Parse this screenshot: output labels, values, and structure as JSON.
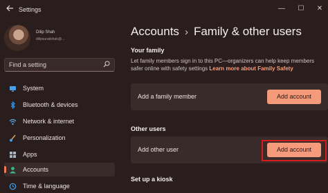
{
  "window": {
    "title": "Settings",
    "back_icon": "back-arrow-icon",
    "minimize_glyph": "—",
    "maximize_glyph": "☐",
    "close_glyph": "✕"
  },
  "user": {
    "name": "Dilip Shah",
    "email": "dilipsuratishah@..."
  },
  "search": {
    "placeholder": "Find a setting",
    "icon": "search-icon"
  },
  "sidebar": {
    "items": [
      {
        "label": "System",
        "icon": "monitor-icon",
        "color": "#4aa0e6",
        "active": false
      },
      {
        "label": "Bluetooth & devices",
        "icon": "bluetooth-icon",
        "color": "#3b8fd9",
        "active": false
      },
      {
        "label": "Network & internet",
        "icon": "wifi-icon",
        "color": "#5aa9e6",
        "active": false
      },
      {
        "label": "Personalization",
        "icon": "brush-icon",
        "color": "#e0a050",
        "active": false
      },
      {
        "label": "Apps",
        "icon": "apps-grid-icon",
        "color": "#a7b4c4",
        "active": false
      },
      {
        "label": "Accounts",
        "icon": "person-icon",
        "color": "#3bb58a",
        "active": true
      },
      {
        "label": "Time & language",
        "icon": "globe-clock-icon",
        "color": "#4aa0e6",
        "active": false
      }
    ]
  },
  "main": {
    "breadcrumb_parent": "Accounts",
    "breadcrumb_separator": "›",
    "breadcrumb_current": "Family & other users",
    "your_family": {
      "title": "Your family",
      "description": "Let family members sign in to this PC—organizers can help keep members safer online with safety settings",
      "learn_more": "Learn more about Family Safety",
      "card_label": "Add a family member",
      "button": "Add account"
    },
    "other_users": {
      "title": "Other users",
      "card_label": "Add other user",
      "button": "Add account"
    },
    "kiosk": {
      "title": "Set up a kiosk"
    }
  },
  "colors": {
    "background": "#2a1d1d",
    "card": "#3a2b2b",
    "accent": "#f59a7a",
    "link": "#f6a07e",
    "highlight_box": "#d41e1e"
  }
}
